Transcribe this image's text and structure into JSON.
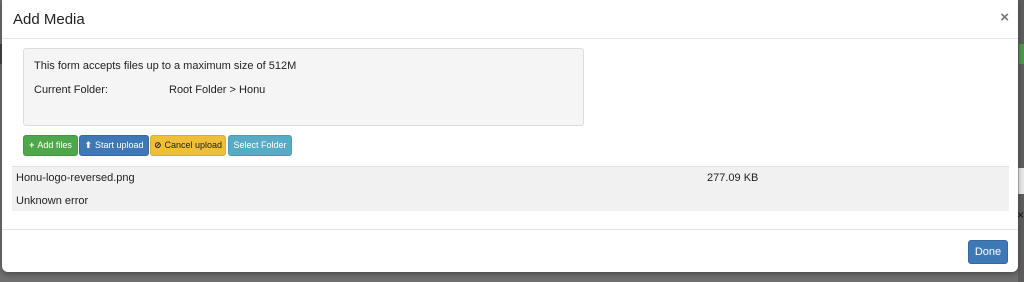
{
  "modal": {
    "title": "Add Media",
    "close_label": "×"
  },
  "info": {
    "max_size_text": "This form accepts files up to a maximum size of 512M",
    "current_folder_label": "Current Folder:",
    "current_folder_value": "Root Folder > Honu"
  },
  "toolbar": {
    "add_files": {
      "icon": "plus-icon",
      "glyph": "+",
      "label": "Add files"
    },
    "start_upload": {
      "icon": "upload-icon",
      "glyph": "⬆",
      "label": "Start upload"
    },
    "cancel_upload": {
      "icon": "ban-icon",
      "glyph": "⊘",
      "label": "Cancel upload"
    },
    "select_folder": {
      "label": "Select Folder"
    }
  },
  "files": [
    {
      "name": "Honu-logo-reversed.png",
      "size": "277.09 KB",
      "error": "Unknown error"
    }
  ],
  "footer": {
    "done_label": "Done"
  },
  "colors": {
    "success": "#4fa64b",
    "primary": "#3f78b6",
    "warning": "#f0bf3a",
    "info": "#58abc5"
  }
}
